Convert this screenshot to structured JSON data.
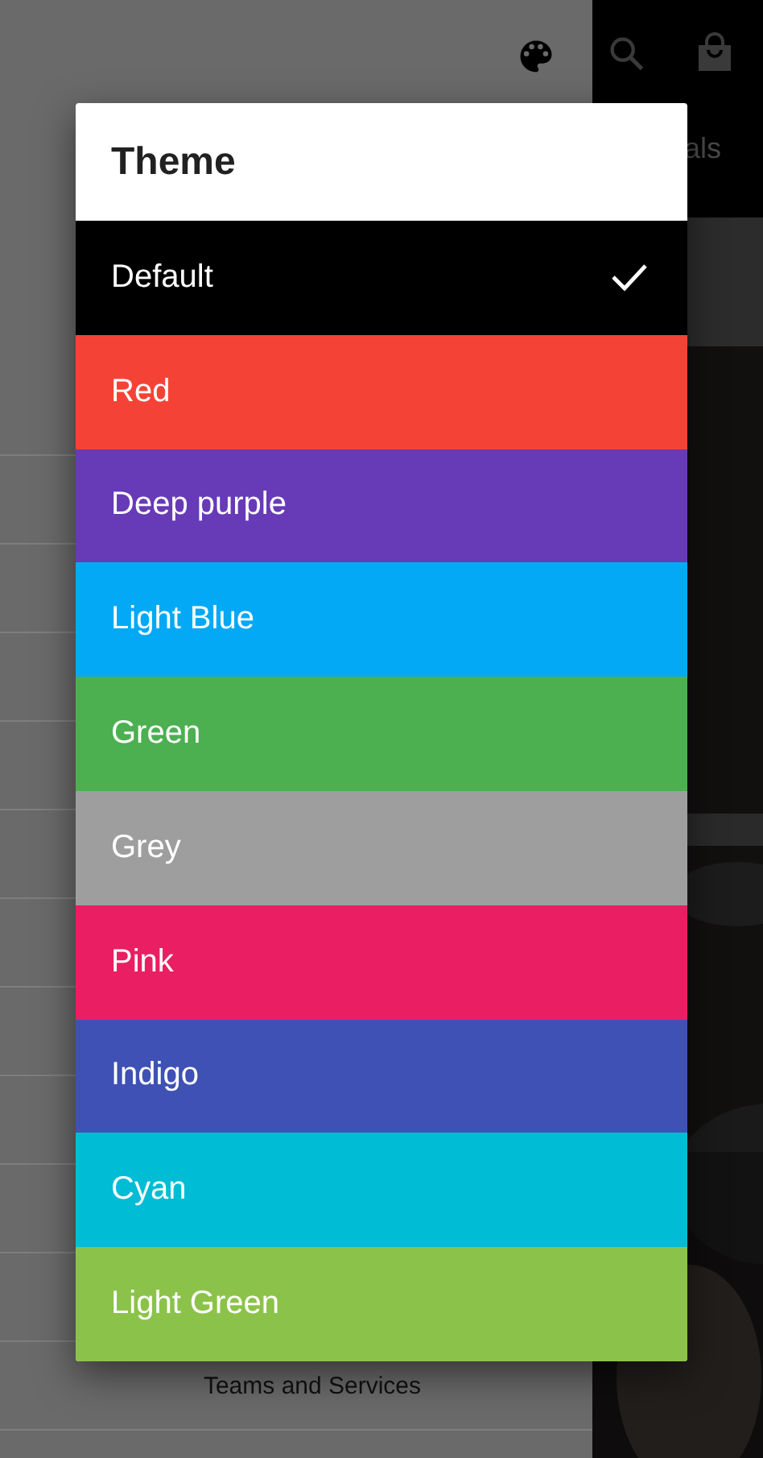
{
  "app_bar": {
    "tab_partial": "als"
  },
  "drawer": {
    "items": [
      {
        "label": "Teams and Services"
      }
    ]
  },
  "dialog": {
    "title": "Theme",
    "options": [
      {
        "label": "Default",
        "color": "#000000",
        "selected": true
      },
      {
        "label": "Red",
        "color": "#f44336",
        "selected": false
      },
      {
        "label": "Deep purple",
        "color": "#673ab7",
        "selected": false
      },
      {
        "label": "Light Blue",
        "color": "#03a9f4",
        "selected": false
      },
      {
        "label": "Green",
        "color": "#4caf50",
        "selected": false
      },
      {
        "label": "Grey",
        "color": "#9e9e9e",
        "selected": false
      },
      {
        "label": "Pink",
        "color": "#e91e63",
        "selected": false
      },
      {
        "label": "Indigo",
        "color": "#3f51b5",
        "selected": false
      },
      {
        "label": "Cyan",
        "color": "#00bcd4",
        "selected": false
      },
      {
        "label": "Light Green",
        "color": "#8bc34a",
        "selected": false
      }
    ]
  }
}
